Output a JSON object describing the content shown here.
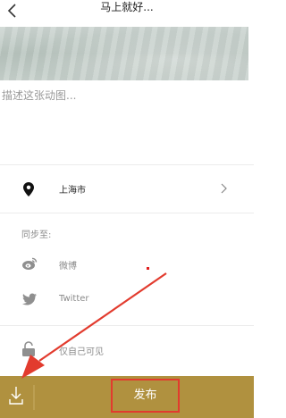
{
  "header": {
    "title": "马上就好..."
  },
  "description_placeholder": "描述这张动图...",
  "location": {
    "city": "上海市"
  },
  "sync": {
    "label": "同步至:",
    "items": [
      {
        "label": "微博",
        "icon": "weibo-icon"
      },
      {
        "label": "Twitter",
        "icon": "twitter-icon"
      }
    ]
  },
  "privacy": {
    "label": "仅自己可见",
    "icon": "lock-icon"
  },
  "bottom_bar": {
    "publish_label": "发布",
    "download_icon": "download-icon"
  },
  "colors": {
    "bar": "#b0913f",
    "annotation_red": "#e23b2e",
    "muted_text": "#8a8a8a"
  }
}
